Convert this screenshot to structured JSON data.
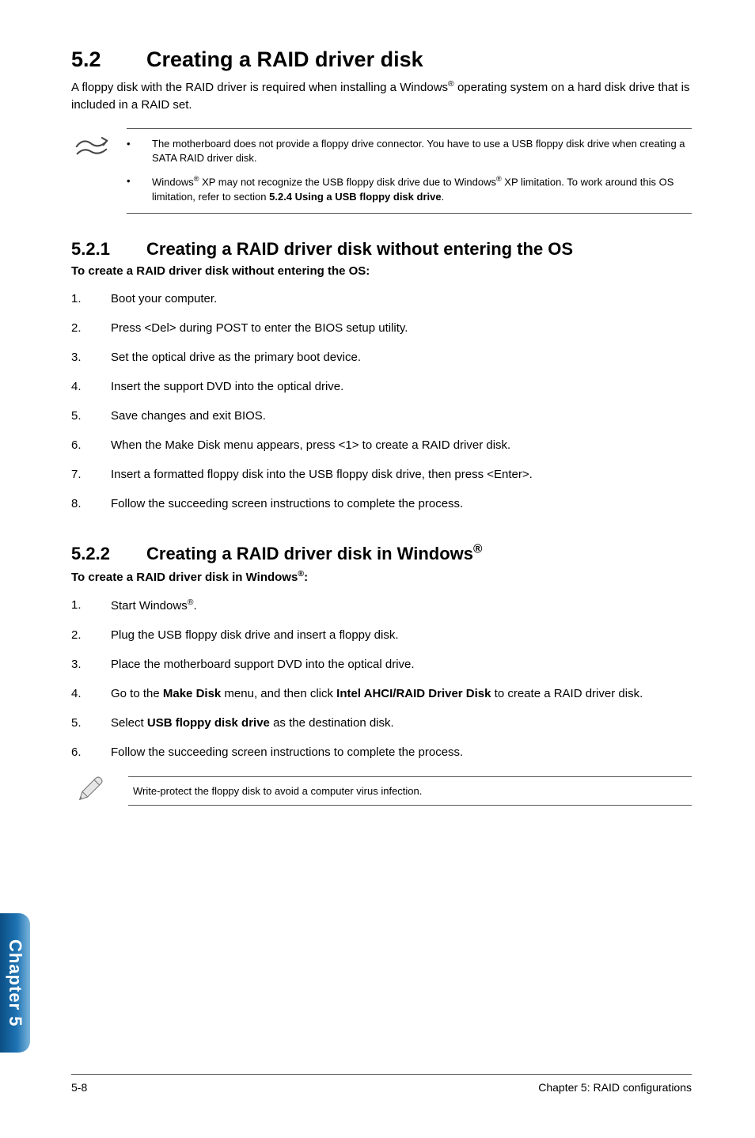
{
  "section": {
    "num": "5.2",
    "title": "Creating a RAID driver disk"
  },
  "intro_parts": {
    "p1": "A floppy disk with the RAID driver is required when installing a Windows",
    "sup1": "®",
    "p2": " operating system on a hard disk drive that is included in a RAID set."
  },
  "note_bullets": [
    {
      "text": "The motherboard does not provide a floppy drive connector. You have to use a USB floppy disk drive when creating a SATA RAID driver disk."
    },
    {
      "pre1": "Windows",
      "sup1": "®",
      "mid1": " XP may not recognize the USB floppy disk drive due to Windows",
      "sup2": "®",
      "mid2": " XP limitation. To work around this OS limitation, refer to section ",
      "bold": "5.2.4 Using a USB floppy disk drive",
      "post": "."
    }
  ],
  "sub1": {
    "num": "5.2.1",
    "title": "Creating a RAID driver disk without entering the OS",
    "subhead": "To create a RAID driver disk without entering the OS:",
    "steps": [
      "Boot your computer.",
      "Press <Del> during POST to enter the BIOS setup utility.",
      "Set the optical drive as the primary boot device.",
      "Insert the support DVD into the optical drive.",
      "Save changes and exit BIOS.",
      "When the Make Disk menu appears, press <1> to create a RAID driver disk.",
      "Insert a formatted floppy disk into the USB floppy disk drive, then press <Enter>.",
      "Follow the succeeding screen instructions to complete the process."
    ]
  },
  "sub2": {
    "num": "5.2.2",
    "title_pre": "Creating a RAID driver disk in Windows",
    "title_sup": "®",
    "subhead_pre": "To create a RAID driver disk in Windows",
    "subhead_sup": "®",
    "subhead_post": ":",
    "steps": [
      {
        "pre": "Start Windows",
        "sup": "®",
        "post": "."
      },
      {
        "text": "Plug the USB floppy disk drive and insert a floppy disk."
      },
      {
        "text": "Place the motherboard support DVD into the optical drive."
      },
      {
        "pre": "Go to the ",
        "b1": "Make Disk",
        "mid": " menu, and then click ",
        "b2": "Intel AHCI/RAID Driver Disk",
        "post": " to create a RAID driver disk."
      },
      {
        "pre": "Select ",
        "b1": "USB floppy disk drive",
        "post": " as the destination disk."
      },
      {
        "text": "Follow the succeeding screen instructions to complete the process."
      }
    ]
  },
  "tip": "Write-protect the floppy disk to avoid a computer virus infection.",
  "tab": "Chapter 5",
  "footer": {
    "left": "5-8",
    "right": "Chapter 5: RAID configurations"
  }
}
